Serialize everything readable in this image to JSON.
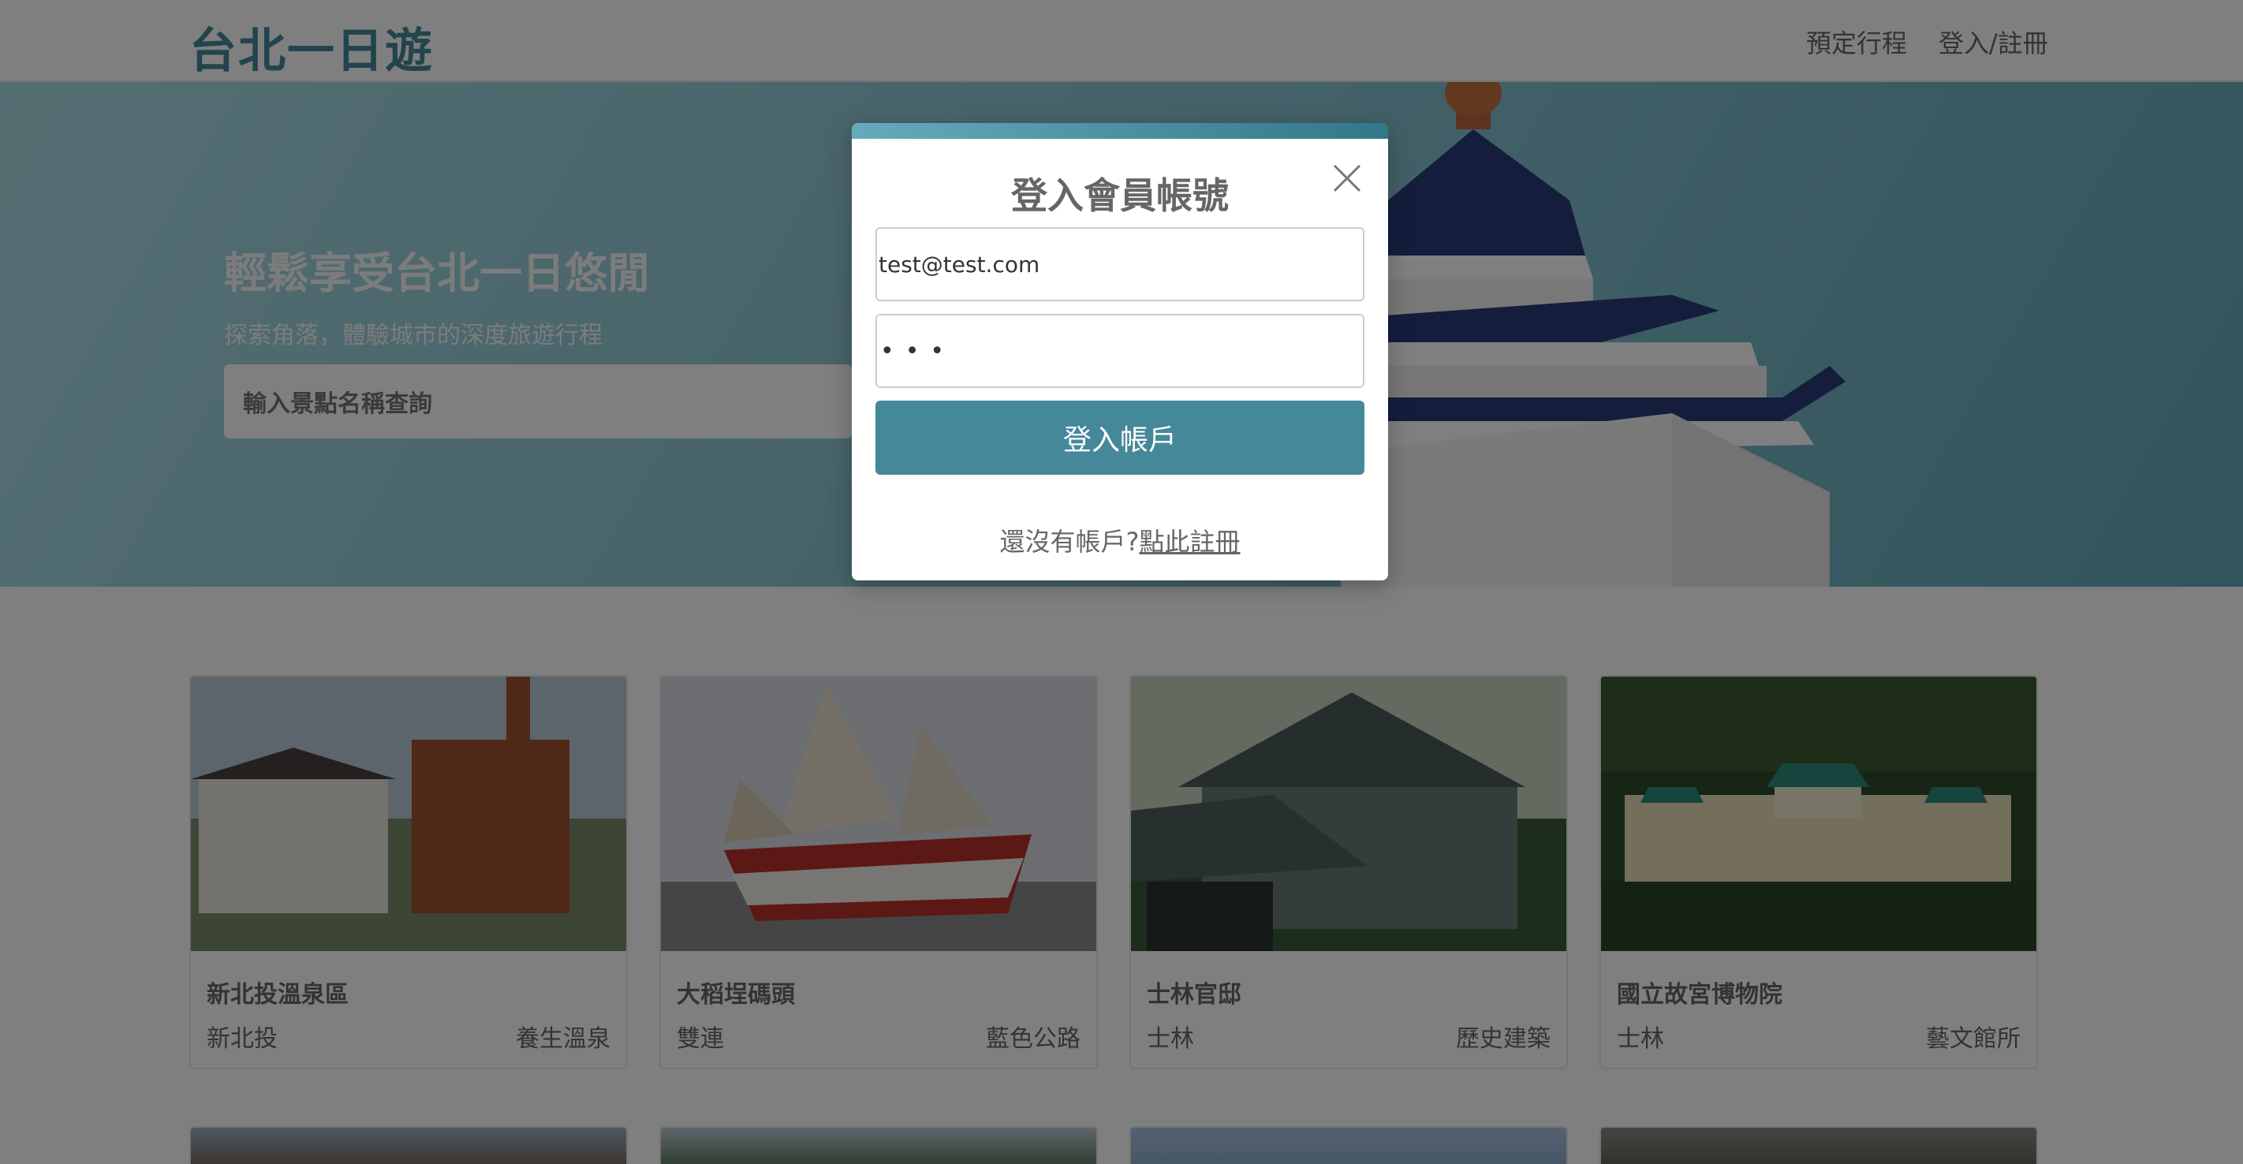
{
  "nav": {
    "brand": "台北一日遊",
    "links": [
      "預定行程",
      "登入/註冊"
    ]
  },
  "hero": {
    "title": "輕鬆享受台北一日悠閒",
    "subtitle": "探索角落，體驗城市的深度旅遊行程",
    "search_placeholder": "輸入景點名稱查詢"
  },
  "attractions": [
    {
      "name": "新北投溫泉區",
      "mrt": "新北投",
      "category": "養生溫泉"
    },
    {
      "name": "大稻埕碼頭",
      "mrt": "雙連",
      "category": "藍色公路"
    },
    {
      "name": "士林官邸",
      "mrt": "士林",
      "category": "歷史建築"
    },
    {
      "name": "國立故宮博物院",
      "mrt": "士林",
      "category": "藝文館所"
    }
  ],
  "modal": {
    "title": "登入會員帳號",
    "email_value": "test@test.com",
    "password_display": "•••",
    "submit_label": "登入帳戶",
    "footer_text": "還沒有帳戶?",
    "footer_link": "點此註冊"
  },
  "icons": {
    "close": "close-icon",
    "search": "search-icon"
  },
  "colors": {
    "brand": "#448899",
    "overlay": "rgba(0,0,0,0.5)"
  }
}
